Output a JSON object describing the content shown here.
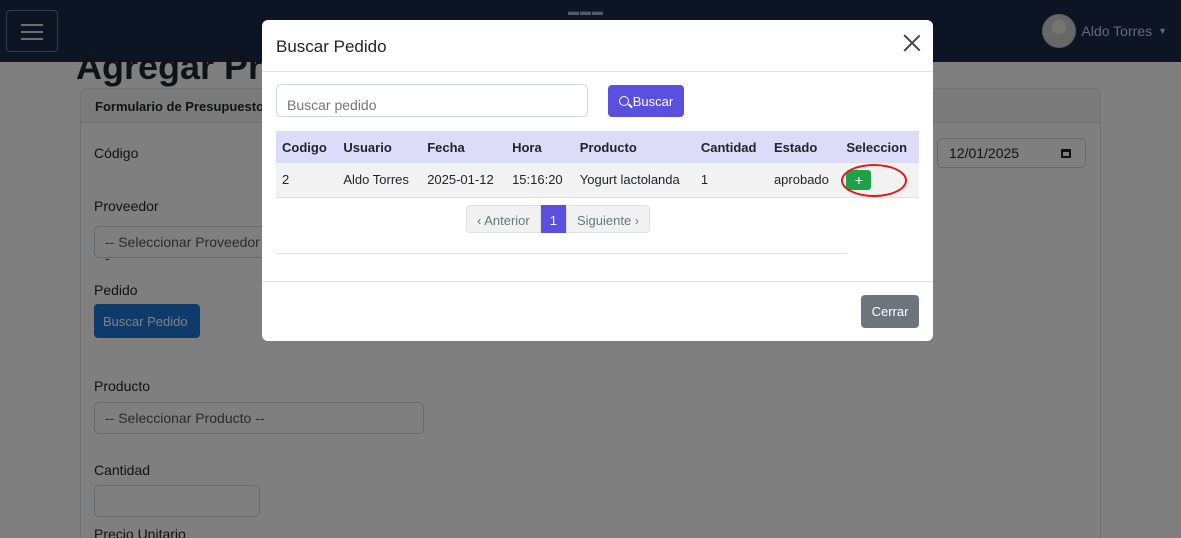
{
  "header": {
    "logo_text": "▬▬▬",
    "user_name": "Aldo Torres"
  },
  "page": {
    "title": "Agregar Pre",
    "card_header": "Formulario de Presupuesto",
    "labels": {
      "codigo": "Código",
      "proveedor": "Proveedor",
      "pedido": "Pedido",
      "producto": "Producto",
      "cantidad": "Cantidad",
      "precio_unitario": "Precio Unitario"
    },
    "proveedor_select": "-- Seleccionar Proveedor --",
    "producto_select": "-- Seleccionar Producto --",
    "buscar_pedido_button": "Buscar Pedido",
    "date_value": "12/01/2025"
  },
  "modal": {
    "title": "Buscar Pedido",
    "search_placeholder": "Buscar pedido",
    "search_button": "Buscar",
    "columns": [
      "Codigo",
      "Usuario",
      "Fecha",
      "Hora",
      "Producto",
      "Cantidad",
      "Estado",
      "Seleccion"
    ],
    "rows": [
      {
        "codigo": "2",
        "usuario": "Aldo Torres",
        "fecha": "2025-01-12",
        "hora": "15:16:20",
        "producto": "Yogurt lactolanda",
        "cantidad": "1",
        "estado": "aprobado",
        "select_label": "+"
      }
    ],
    "pagination": {
      "prev": "‹ Anterior",
      "current": "1",
      "next": "Siguiente ›"
    },
    "close_button": "Cerrar"
  },
  "colors": {
    "accent": "#5b4fe0",
    "add_button": "#1fa148",
    "highlight_ring": "#e11b1b",
    "header_bg": "#dcdcf8"
  }
}
